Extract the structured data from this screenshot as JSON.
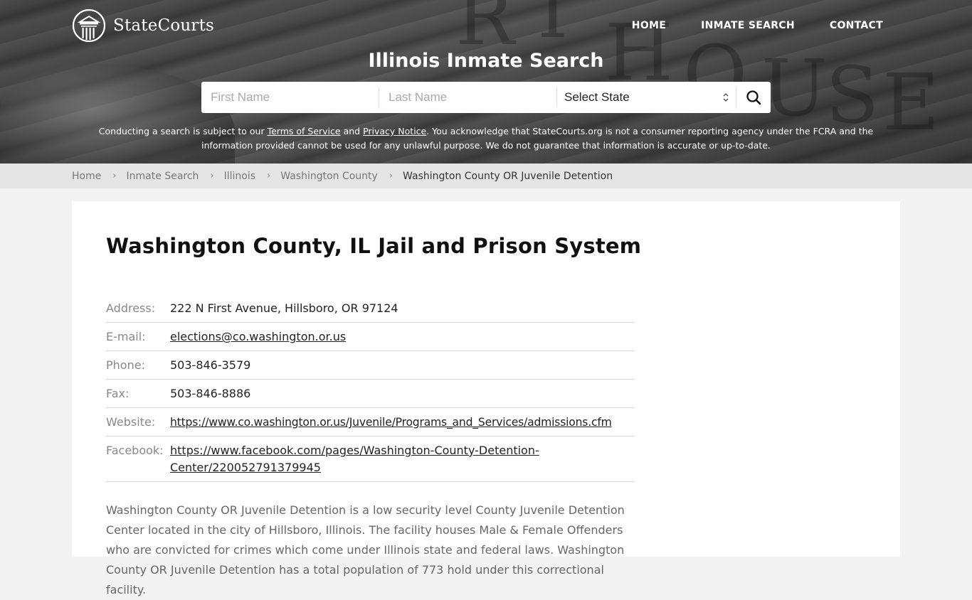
{
  "header": {
    "logo_text": "StateCourts",
    "nav": [
      {
        "label": "HOME"
      },
      {
        "label": "INMATE SEARCH"
      },
      {
        "label": "CONTACT"
      }
    ]
  },
  "hero": {
    "title": "Illinois Inmate Search",
    "background_letters": [
      "R",
      "T",
      "H",
      "O",
      "U",
      "S",
      "E"
    ],
    "search": {
      "first_name_placeholder": "First Name",
      "last_name_placeholder": "Last Name",
      "state_selected": "Select State",
      "search_icon": "search-icon"
    },
    "disclaimer": {
      "part1": "Conducting a search is subject to our ",
      "terms_link": "Terms of Service",
      "part2": " and ",
      "privacy_link": "Privacy Notice",
      "part3": ". You acknowledge that StateCourts.org is not a consumer reporting agency under the FCRA and the information provided cannot be used for any unlawful purpose. We do not guarantee that information is accurate or up-to-date."
    }
  },
  "breadcrumb": [
    {
      "label": "Home"
    },
    {
      "label": "Inmate Search"
    },
    {
      "label": "Illinois"
    },
    {
      "label": "Washington County"
    },
    {
      "label": "Washington County OR Juvenile Detention"
    }
  ],
  "main": {
    "title": "Washington County, IL Jail and Prison System",
    "info": [
      {
        "label": "Address:",
        "value": "222 N First Avenue, Hillsboro, OR 97124",
        "link": false
      },
      {
        "label": "E-mail:",
        "value": "elections@co.washington.or.us",
        "link": true
      },
      {
        "label": "Phone:",
        "value": "503-846-3579",
        "link": false
      },
      {
        "label": "Fax:",
        "value": "503-846-8886",
        "link": false
      },
      {
        "label": "Website:",
        "value": "https://www.co.washington.or.us/Juvenile/Programs_and_Services/admissions.cfm",
        "link": true
      },
      {
        "label": "Facebook:",
        "value": "https://www.facebook.com/pages/Washington-County-Detention-Center/220052791379945",
        "link": true
      }
    ],
    "description": "Washington County OR Juvenile Detention is a low security level County Juvenile Detention Center located in the city of Hillsboro, Illinois. The facility houses Male & Female Offenders who are convicted for crimes which come under Illinois state and federal laws. Washington County OR Juvenile Detention has a total population of 773 hold under this correctional facility."
  }
}
